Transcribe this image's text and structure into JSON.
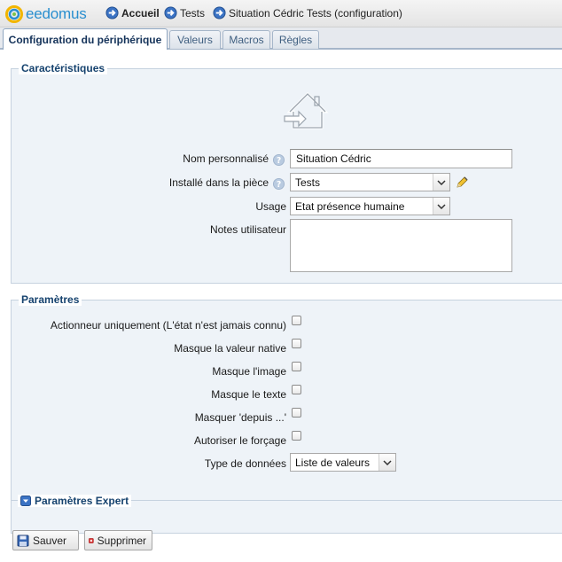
{
  "app": {
    "logo_text": "eedomus",
    "brand_color": "#2a8fcf"
  },
  "breadcrumbs": [
    {
      "label": "Accueil",
      "icon": "nav-arrow-icon"
    },
    {
      "label": "Tests",
      "icon": "nav-arrow-icon"
    },
    {
      "label": "Situation Cédric Tests (configuration)",
      "icon": "nav-arrow-icon"
    }
  ],
  "tabs": [
    {
      "label": "Configuration du périphérique",
      "active": true
    },
    {
      "label": "Valeurs",
      "active": false
    },
    {
      "label": "Macros",
      "active": false
    },
    {
      "label": "Règles",
      "active": false
    }
  ],
  "caracteristiques": {
    "legend": "Caractéristiques",
    "device_icon": "house-arrow-icon",
    "nom_label": "Nom personnalisé",
    "nom_value": "Situation Cédric",
    "piece_label": "Installé dans la pièce",
    "piece_value": "Tests",
    "usage_label": "Usage",
    "usage_value": "Etat présence humaine",
    "notes_label": "Notes utilisateur",
    "notes_value": ""
  },
  "parametres": {
    "legend": "Paramètres",
    "options": [
      {
        "label": "Actionneur uniquement (L'état n'est jamais connu)",
        "checked": false
      },
      {
        "label": "Masque la valeur native",
        "checked": false
      },
      {
        "label": "Masque l'image",
        "checked": false
      },
      {
        "label": "Masque le texte",
        "checked": false
      },
      {
        "label": "Masquer 'depuis ...'",
        "checked": false
      },
      {
        "label": "Autoriser le forçage",
        "checked": false
      }
    ],
    "type_label": "Type de données",
    "type_value": "Liste de valeurs"
  },
  "expert": {
    "legend": "Paramètres Expert"
  },
  "actions": {
    "save_label": "Sauver",
    "delete_label": "Supprimer"
  }
}
